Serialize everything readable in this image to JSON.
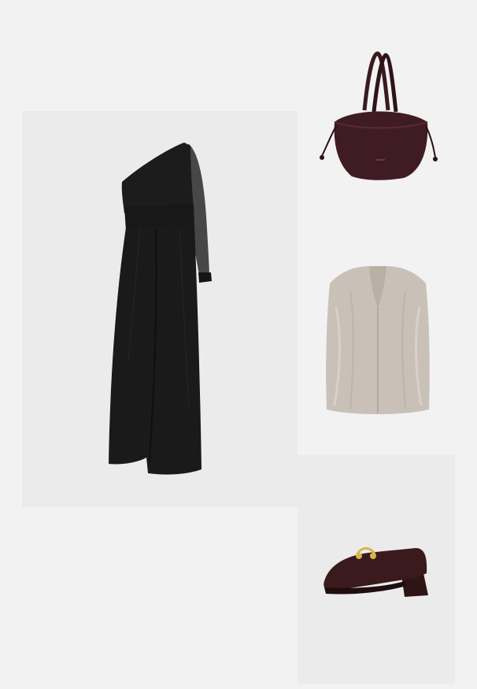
{
  "products": [
    {
      "id": "jumpsuit",
      "icon": "jumpsuit-image",
      "color": "#1b1b1b"
    },
    {
      "id": "bag",
      "icon": "bucket-bag-image",
      "color": "#3f1c24"
    },
    {
      "id": "vest",
      "icon": "fur-vest-image",
      "color": "#c9c1b8"
    },
    {
      "id": "loafer",
      "icon": "loafer-image",
      "color": "#3a1a1c"
    }
  ],
  "colors": {
    "page_background": "#f2f2f2",
    "panel_background": "#ebebeb"
  }
}
